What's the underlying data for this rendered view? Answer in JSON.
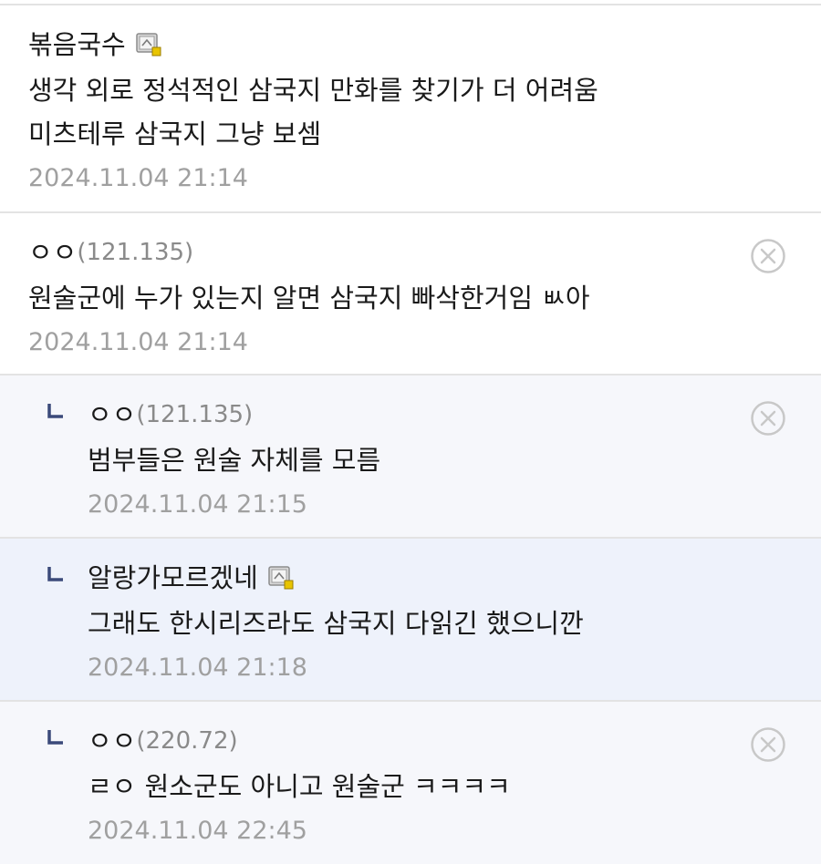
{
  "comments": [
    {
      "author": "볶음국수",
      "ip": "",
      "body": "생각 외로 정석적인 삼국지 만화를 찾기가 더 어려움\n미츠테루 삼국지 그냥 보셈",
      "date": "2024.11.04 21:14",
      "member_icon": "member-badge-icon",
      "is_reply": false,
      "has_delete": false
    },
    {
      "author": "ㅇㅇ",
      "ip": "(121.135)",
      "body": "원술군에 누가 있는지 알면 삼국지 빠삭한거임 ㅄ아",
      "date": "2024.11.04 21:14",
      "is_reply": false,
      "has_delete": true
    },
    {
      "author": "ㅇㅇ",
      "ip": "(121.135)",
      "body": "범부들은 원술 자체를 모름",
      "date": "2024.11.04 21:15",
      "is_reply": true,
      "has_delete": true
    },
    {
      "author": "알랑가모르겠네",
      "ip": "",
      "body": "그래도 한시리즈라도 삼국지 다읽긴 했으니깐",
      "date": "2024.11.04 21:18",
      "member_icon": "member-badge-icon",
      "is_reply": true,
      "has_delete": false
    },
    {
      "author": "ㅇㅇ",
      "ip": "(220.72)",
      "body": "ㄹㅇ 원소군도 아니고 원술군 ㅋㅋㅋㅋ",
      "date": "2024.11.04 22:45",
      "is_reply": true,
      "has_delete": true
    }
  ],
  "icons": {
    "reply": "reply-arrow-icon",
    "delete": "delete-circle-x-icon",
    "member": "member-badge-icon"
  },
  "colors": {
    "reply_arrow": "#3b4a7a",
    "date": "#a0a0a0",
    "ip": "#8a8a8a",
    "divider": "#e3e3e3",
    "reply_bg": "#f6f7fb",
    "highlight_bg": "#eef2fb",
    "member_badge_accent": "#e8c400"
  }
}
